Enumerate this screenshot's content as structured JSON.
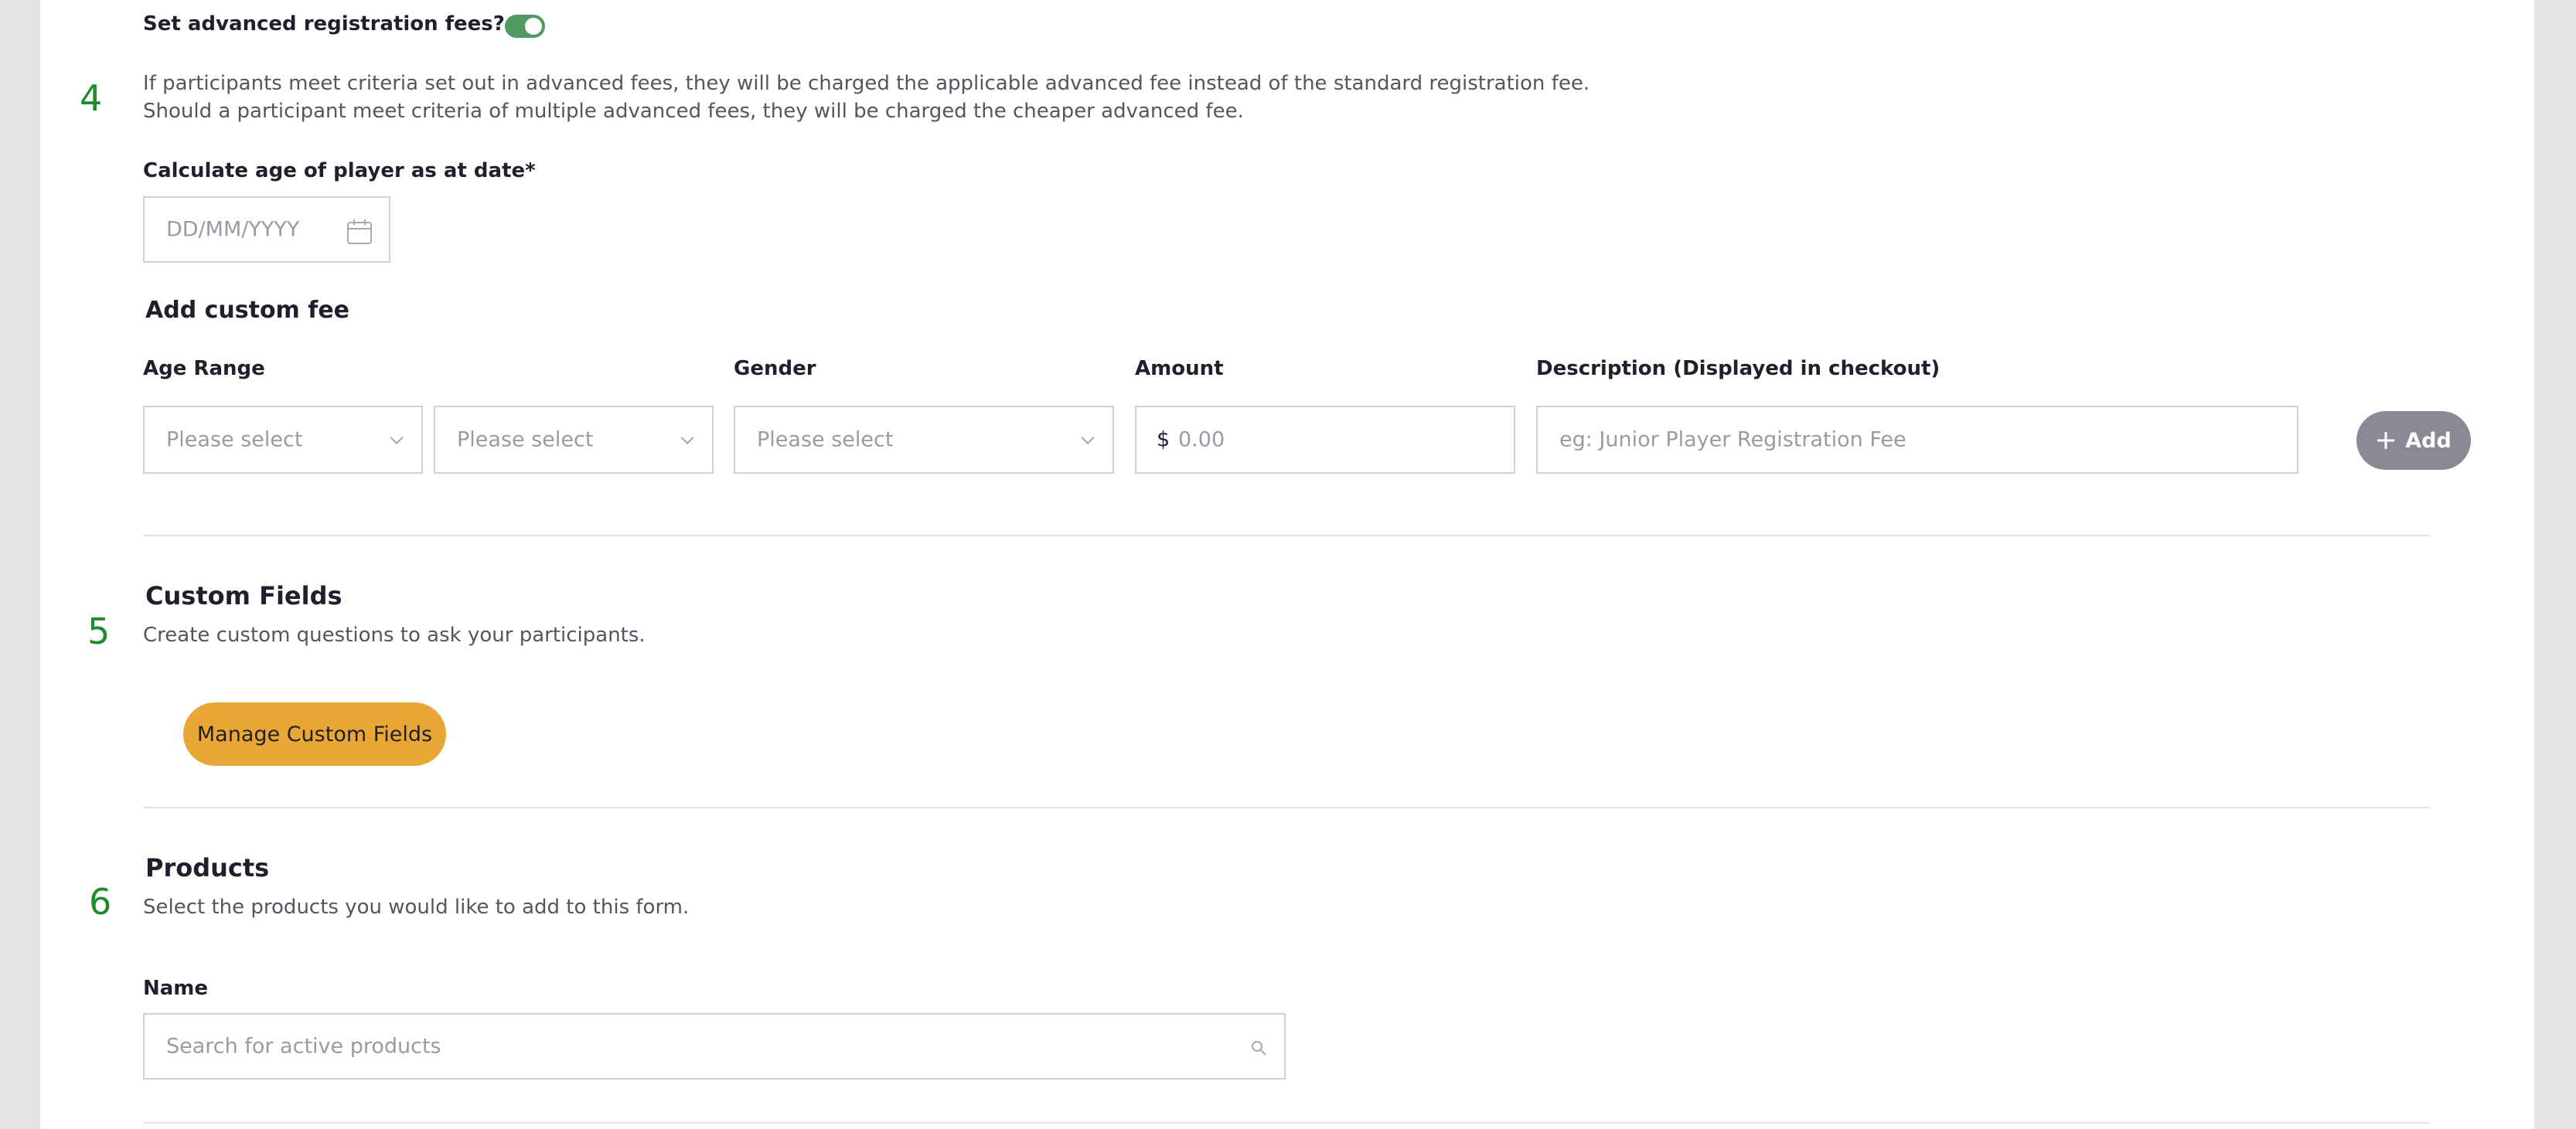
{
  "steps": {
    "s4": "4",
    "s5": "5",
    "s6": "6"
  },
  "advanced_fees": {
    "toggle_label": "Set advanced registration fees?",
    "toggle_on": true,
    "desc_line1": "If participants meet criteria set out in advanced fees, they will be charged the applicable advanced fee instead of the standard registration fee.",
    "desc_line2": "Should a participant meet criteria of multiple advanced fees, they will be charged the cheaper advanced fee.",
    "age_date_label": "Calculate age of player as at date",
    "required_mark": "*",
    "date_placeholder": "DD/MM/YYYY"
  },
  "custom_fee": {
    "heading": "Add custom fee",
    "age_range_label": "Age Range",
    "gender_label": "Gender",
    "amount_label": "Amount",
    "description_label": "Description (Displayed in checkout)",
    "age_from_placeholder": "Please select",
    "age_to_placeholder": "Please select",
    "gender_placeholder": "Please select",
    "currency_symbol": "$",
    "amount_placeholder": "0.00",
    "description_placeholder": "eg: Junior Player Registration Fee",
    "add_button": "Add"
  },
  "custom_fields": {
    "heading": "Custom Fields",
    "description": "Create custom questions to ask your participants.",
    "manage_button": "Manage Custom Fields"
  },
  "products": {
    "heading": "Products",
    "description": "Select the products you would like to add to this form.",
    "name_label": "Name",
    "search_placeholder": "Search for active products"
  },
  "colors": {
    "step_number": "#1e8a2e",
    "toggle_on": "#4f9a61",
    "primary_button": "#eaa735",
    "add_button": "#8a8a96"
  }
}
